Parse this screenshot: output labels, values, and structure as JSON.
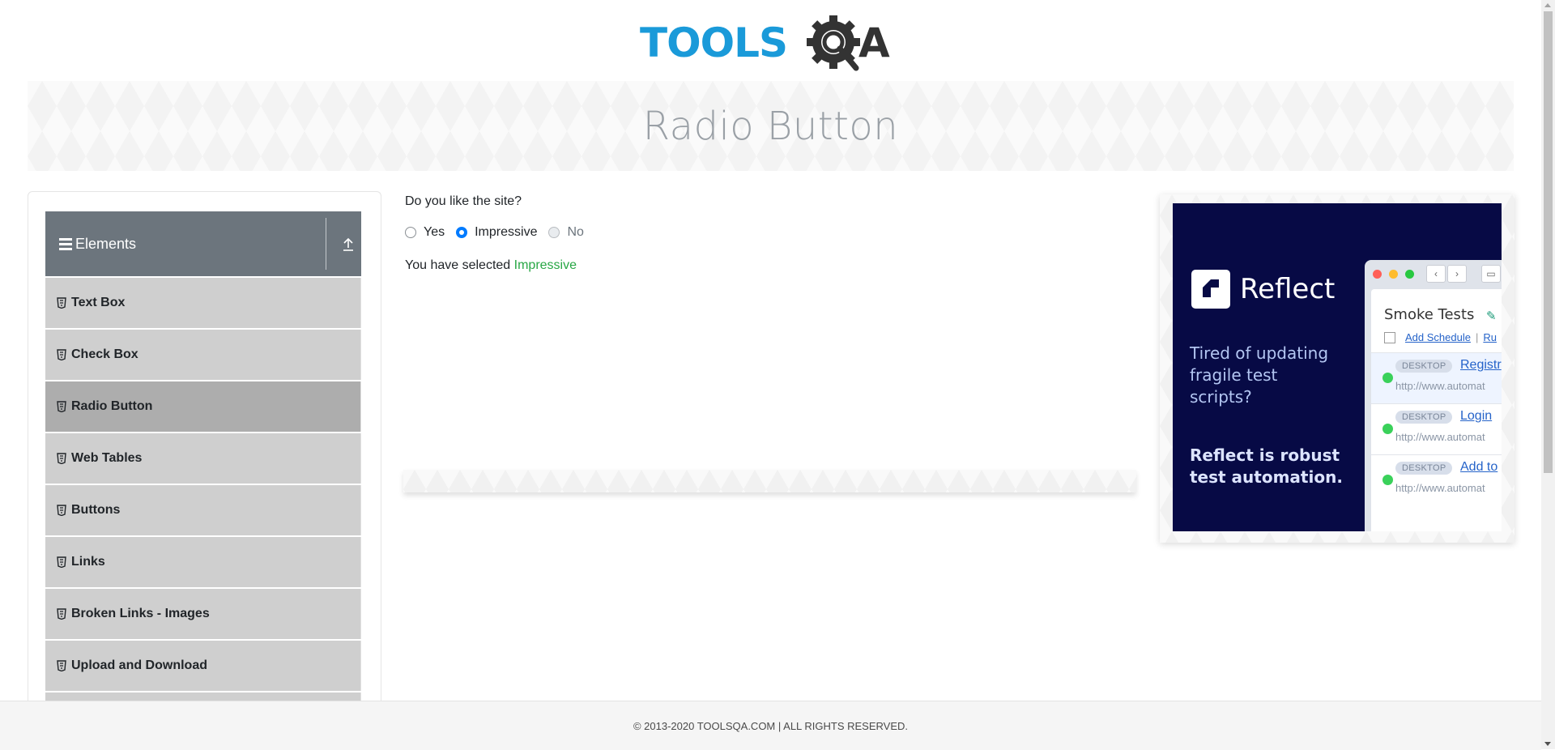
{
  "logo": {
    "text_left": "TOOLS",
    "text_right": "A",
    "primary_color": "#1a9ad9",
    "dark_color": "#333333"
  },
  "banner": {
    "title": "Radio Button"
  },
  "sidebar": {
    "group": {
      "title": "Elements"
    },
    "items": [
      {
        "label": "Text Box",
        "active": false
      },
      {
        "label": "Check Box",
        "active": false
      },
      {
        "label": "Radio Button",
        "active": true
      },
      {
        "label": "Web Tables",
        "active": false
      },
      {
        "label": "Buttons",
        "active": false
      },
      {
        "label": "Links",
        "active": false
      },
      {
        "label": "Broken Links - Images",
        "active": false
      },
      {
        "label": "Upload and Download",
        "active": false
      }
    ]
  },
  "main": {
    "question": "Do you like the site?",
    "options": [
      {
        "label": "Yes",
        "checked": false,
        "disabled": false
      },
      {
        "label": "Impressive",
        "checked": true,
        "disabled": false
      },
      {
        "label": "No",
        "checked": false,
        "disabled": true
      }
    ],
    "result_prefix": "You have selected",
    "result_value": "Impressive",
    "result_color": "#28a745"
  },
  "ad": {
    "brand": "Reflect",
    "tagline1": "Tired of updating fragile test scripts?",
    "tagline2": "Reflect is robust test automation.",
    "mock": {
      "title": "Smoke Tests",
      "schedule_link": "Add Schedule",
      "separator": "|",
      "schedule_link2": "Ru",
      "rows": [
        {
          "badge": "DESKTOP",
          "link": "Registr",
          "url": "http://www.automat"
        },
        {
          "badge": "DESKTOP",
          "link": "Login",
          "url": "http://www.automat"
        },
        {
          "badge": "DESKTOP",
          "link": "Add to",
          "url": "http://www.automat"
        }
      ]
    }
  },
  "footer": {
    "text": "© 2013-2020 TOOLSQA.COM | ALL RIGHTS RESERVED."
  }
}
